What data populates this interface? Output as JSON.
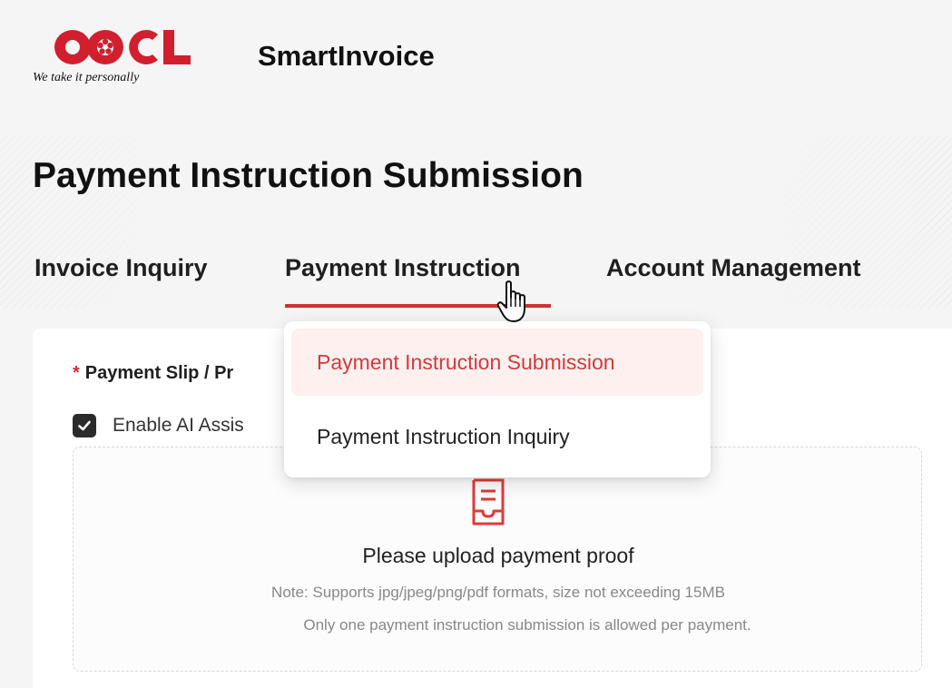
{
  "brand": {
    "logo_text": "OOCL",
    "tagline": "We take it personally",
    "app_name": "SmartInvoice",
    "accent_color": "#d42f2f"
  },
  "page": {
    "title": "Payment Instruction Submission"
  },
  "nav": {
    "items": [
      {
        "label": "Invoice Inquiry"
      },
      {
        "label": "Payment Instruction",
        "active": true
      },
      {
        "label": "Account Management"
      }
    ]
  },
  "dropdown": {
    "items": [
      {
        "label": "Payment Instruction Submission",
        "selected": true
      },
      {
        "label": "Payment Instruction Inquiry"
      }
    ]
  },
  "form": {
    "slip_label": "Payment Slip / Pr",
    "ai_checkbox": {
      "label": "Enable AI Assis",
      "checked": true
    },
    "upload": {
      "icon": "document-tray-icon",
      "title": "Please upload payment proof",
      "note": "Note: Supports jpg/jpeg/png/pdf formats, size not exceeding 15MB",
      "note2": "Only one payment instruction submission is allowed per payment."
    }
  }
}
